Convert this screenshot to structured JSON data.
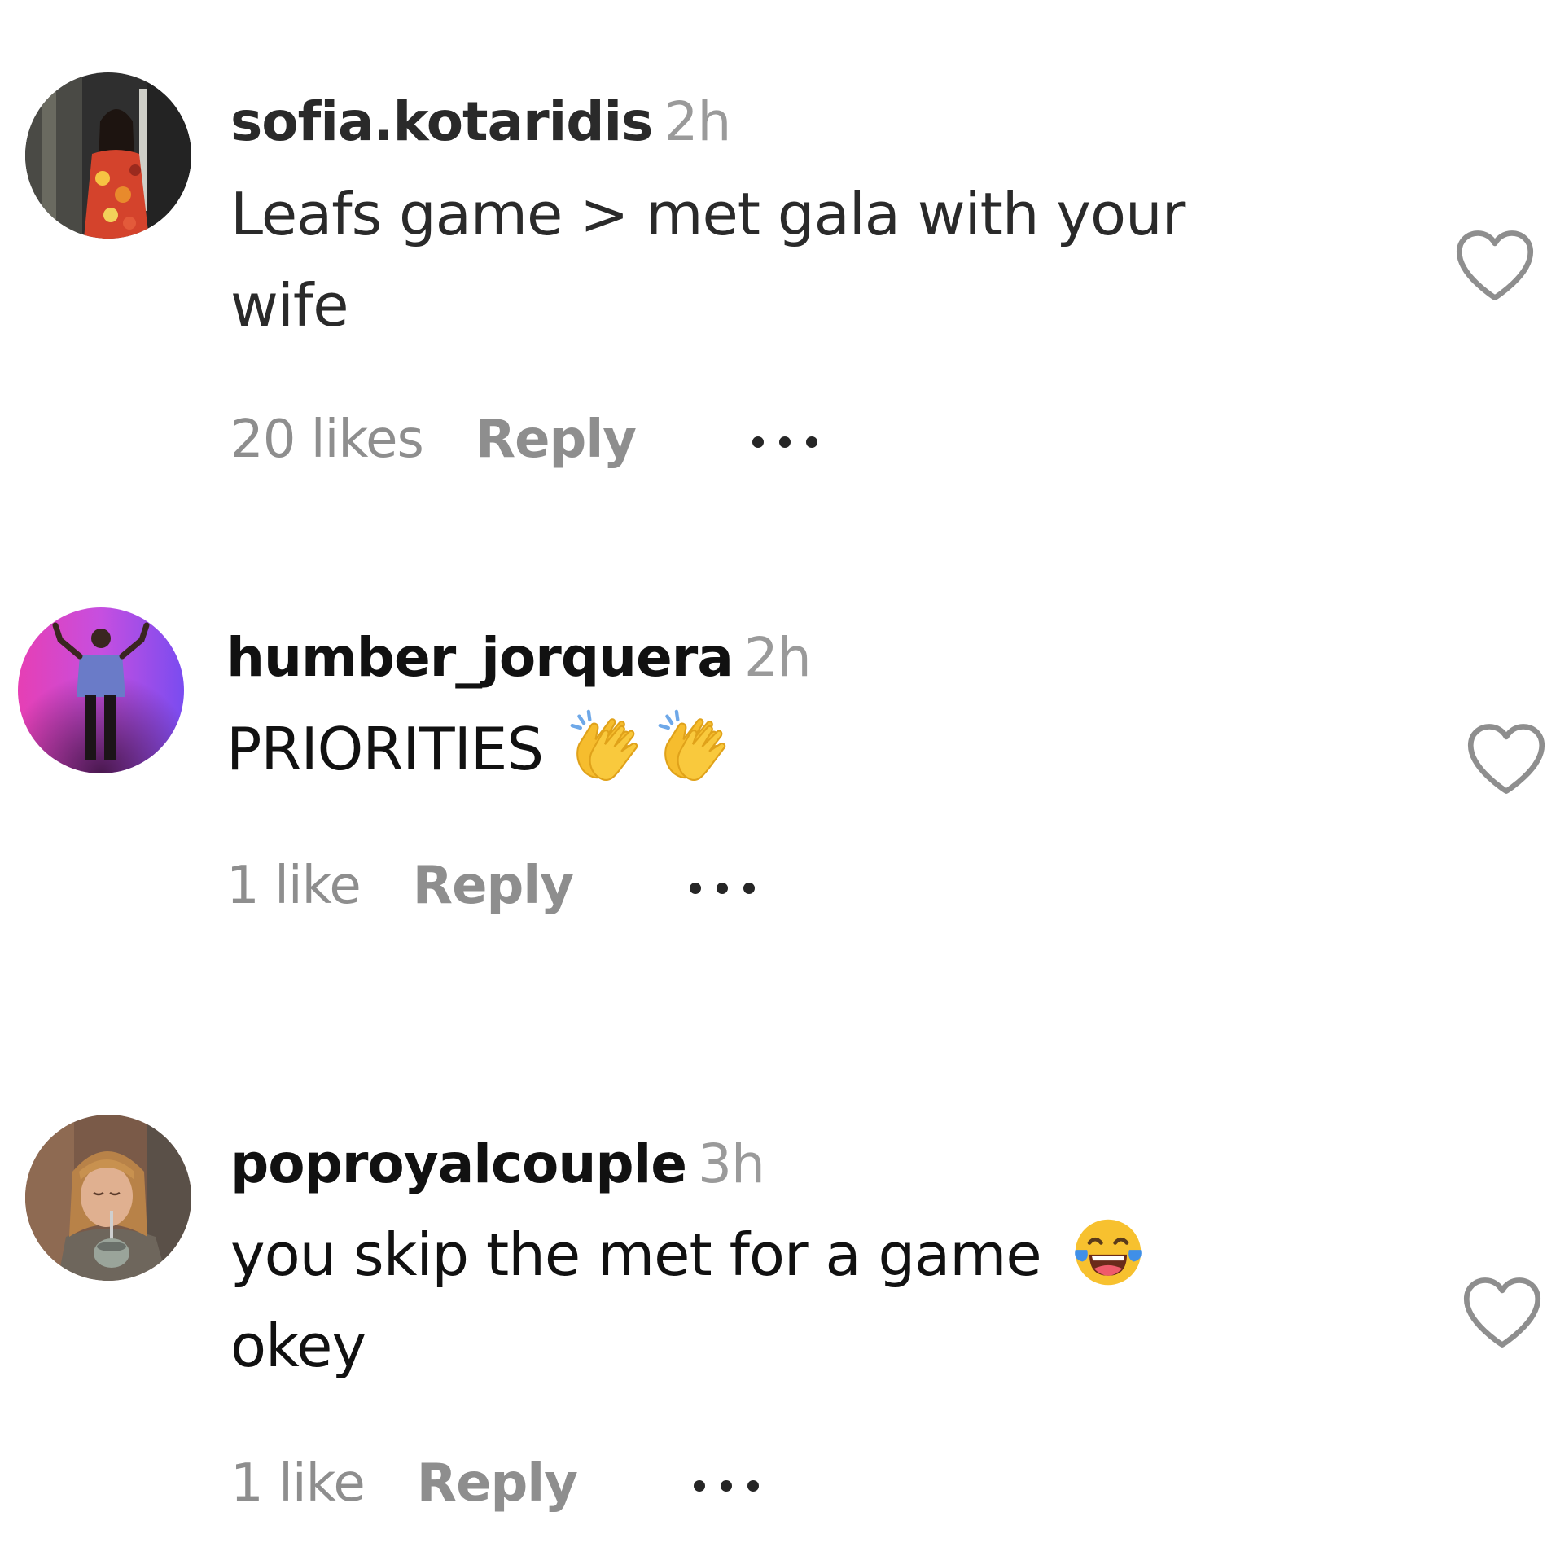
{
  "comments": [
    {
      "username": "sofia.kotaridis",
      "time": "2h",
      "text_lines": [
        "Leafs game > met gala with your",
        "wife"
      ],
      "likes": "20 likes",
      "reply_label": "Reply",
      "avatar_icon": "avatar-woman-floral-dress",
      "heart_icon": "heart-outline-icon",
      "more_icon": "more-options-icon"
    },
    {
      "username": "humber_jorquera",
      "time": "2h",
      "text_lines": [
        "PRIORITIES"
      ],
      "emoji": [
        "clapping-hands",
        "clapping-hands"
      ],
      "likes": "1 like",
      "reply_label": "Reply",
      "avatar_icon": "avatar-person-pink-purple-background",
      "heart_icon": "heart-outline-icon",
      "more_icon": "more-options-icon"
    },
    {
      "username": "poproyalcouple",
      "time": "3h",
      "text_lines": [
        "you skip the met for a game",
        "okey"
      ],
      "emoji": [
        "face-with-tears-of-joy"
      ],
      "likes": "1 like",
      "reply_label": "Reply",
      "avatar_icon": "avatar-woman-drinking-mate",
      "heart_icon": "heart-outline-icon",
      "more_icon": "more-options-icon"
    }
  ],
  "colors": {
    "meta_text": "#8e8e8e",
    "time_text": "#9a9a9a",
    "emoji_yellow": "#f7c12f",
    "tear_blue": "#3f8fe8"
  }
}
